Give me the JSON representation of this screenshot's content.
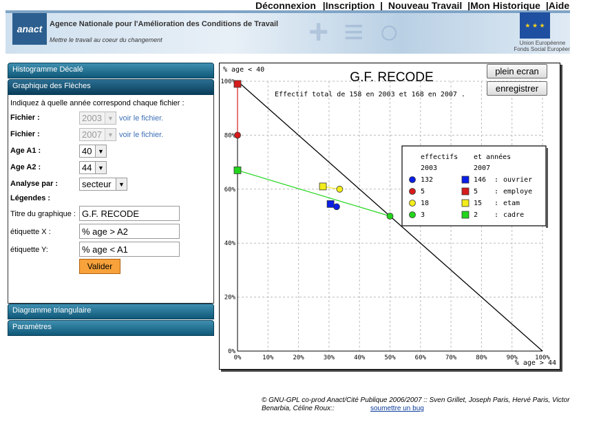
{
  "topnav": {
    "items": [
      "Déconnexion",
      "Inscription",
      "Nouveau Travail",
      "Mon Historique",
      "Aide"
    ]
  },
  "banner": {
    "logo": "anact",
    "agency": "Agence Nationale pour l'Amélioration des Conditions de Travail",
    "motto": "Mettre le travail au coeur du changement",
    "eu_line1": "Union Européenne",
    "eu_line2": "Fonds Social Européen"
  },
  "sidebar": {
    "histogramme": "Histogramme Décalé",
    "fleches": "Graphique des Flèches",
    "diagramme": "Diagramme triangulaire",
    "parametres": "Paramètres",
    "instruction": "Indiquez à quelle année correspond chaque fichier :",
    "fichier_label": "Fichier :",
    "fichier1_value": "2003",
    "fichier2_value": "2007",
    "voir_link": "voir le fichier.",
    "a1_label": "Age A1 :",
    "a1_value": "40",
    "a2_label": "Age A2 :",
    "a2_value": "44",
    "analyse_label": "Analyse par :",
    "analyse_value": "secteur",
    "legendes_label": "Légendes :",
    "titre_label": "Titre du graphique :",
    "titre_value": "G.F. RECODE",
    "etiqx_label": "étiquette X :",
    "etiqx_value": "% age > A2",
    "etiqy_label": "étiquette Y:",
    "etiqy_value": "% age < A1",
    "valider": "Valider"
  },
  "buttons": {
    "plein_ecran": "plein ecran",
    "enregistrer": "enregistrer"
  },
  "chart_data": {
    "type": "scatter",
    "title": "G.F. RECODE",
    "subtitle": "Effectif total de 158 en 2003 et 168 en 2007 .",
    "ylabel": "% age < 40",
    "xlabel": "% age > 44",
    "xlim": [
      0,
      100
    ],
    "ylim": [
      0,
      100
    ],
    "xticks": [
      "0%",
      "10%",
      "20%",
      "30%",
      "40%",
      "50%",
      "60%",
      "70%",
      "80%",
      "90%",
      "100%"
    ],
    "yticks": [
      "0%",
      "20%",
      "40%",
      "60%",
      "80%",
      "100%"
    ],
    "grid": true,
    "legend_header": {
      "col1": "effectifs",
      "col2": "et années",
      "year1": "2003",
      "year2": "2007"
    },
    "series": [
      {
        "name": "ouvrier",
        "color": "#0a1ee6",
        "n2003": "132",
        "n2007": "146",
        "p2003": [
          32.5,
          53.5
        ],
        "p2007": [
          30.5,
          54.5
        ]
      },
      {
        "name": "employe",
        "color": "#d61c1c",
        "n2003": "5",
        "n2007": "5",
        "p2003": [
          0,
          80
        ],
        "p2007": [
          0,
          99
        ]
      },
      {
        "name": "etam",
        "color": "#f2ec1c",
        "n2003": "18",
        "n2007": "15",
        "p2003": [
          33.5,
          60
        ],
        "p2007": [
          28,
          61
        ]
      },
      {
        "name": "cadre",
        "color": "#22d51c",
        "n2003": "3",
        "n2007": "2",
        "p2003": [
          50,
          50
        ],
        "p2007": [
          0,
          67
        ]
      }
    ],
    "colors": {
      "black_line": "#000000",
      "cadre_line": "#22d51c"
    }
  },
  "footer": {
    "text": "© GNU-GPL co-prod Anact/Cité Publique 2006/2007 :: Sven Grillet, Joseph Paris, Hervé Paris, Victor Benarbia, Céline Roux::",
    "link": "soumettre un bug"
  }
}
